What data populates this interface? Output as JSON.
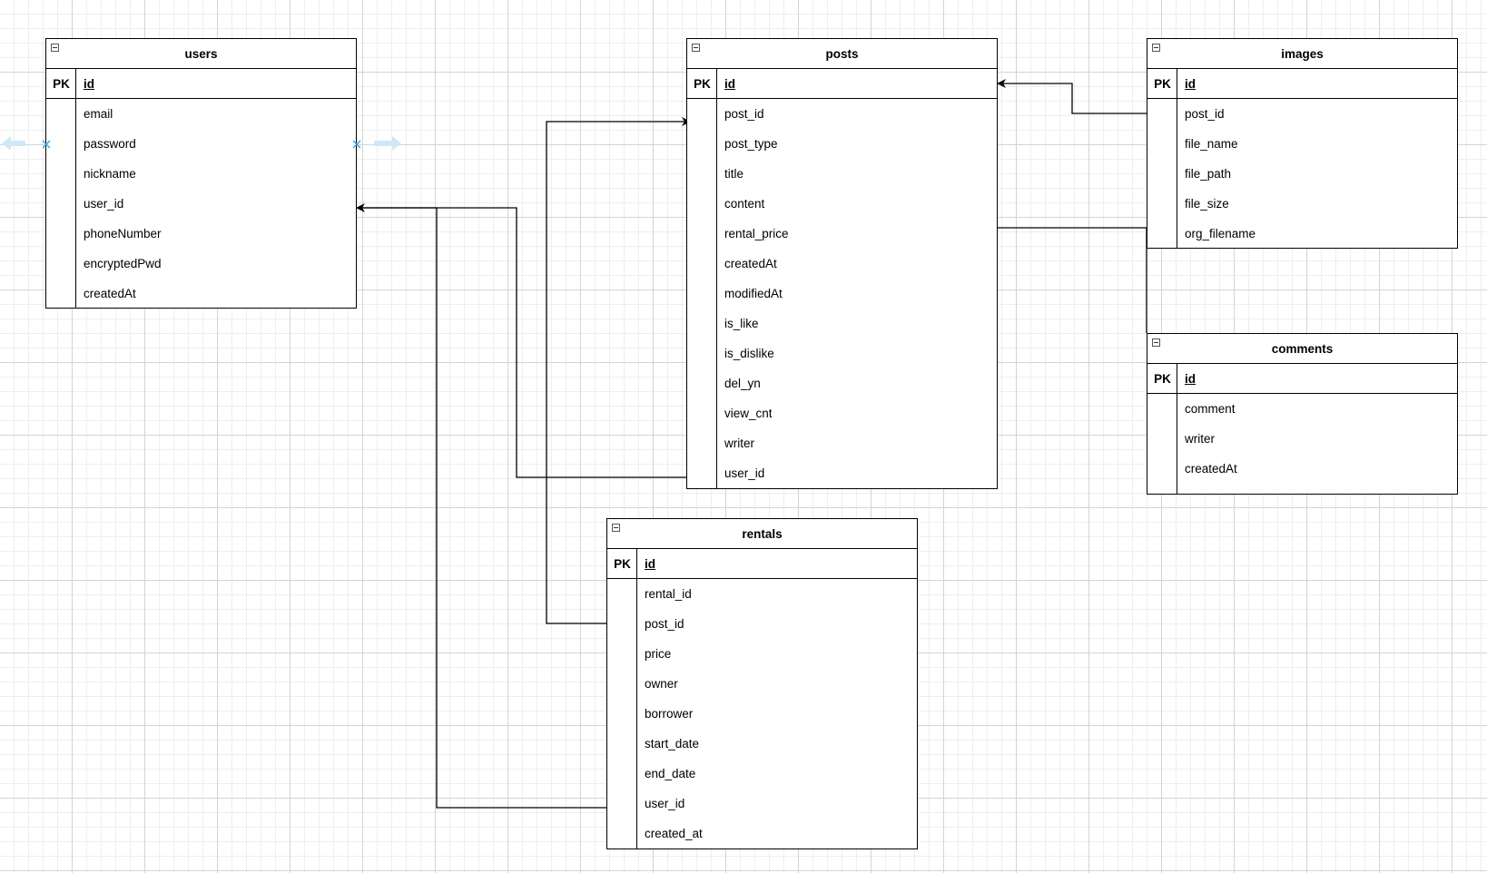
{
  "diagram": {
    "entities": [
      {
        "key": "users",
        "title": "users",
        "pk_label": "PK",
        "pk_field": "id",
        "fields": [
          "email",
          "password",
          "nickname",
          "user_id",
          "phoneNumber",
          "encryptedPwd",
          "createdAt"
        ]
      },
      {
        "key": "posts",
        "title": "posts",
        "pk_label": "PK",
        "pk_field": "id",
        "fields": [
          "post_id",
          "post_type",
          "title",
          "content",
          "rental_price",
          "createdAt",
          "modifiedAt",
          "is_like",
          "is_dislike",
          "del_yn",
          "view_cnt",
          "writer",
          "user_id"
        ]
      },
      {
        "key": "images",
        "title": "images",
        "pk_label": "PK",
        "pk_field": "id",
        "fields": [
          "post_id",
          "file_name",
          "file_path",
          "file_size",
          "org_filename"
        ]
      },
      {
        "key": "comments",
        "title": "comments",
        "pk_label": "PK",
        "pk_field": "id",
        "fields": [
          "comment",
          "writer",
          "createdAt"
        ]
      },
      {
        "key": "rentals",
        "title": "rentals",
        "pk_label": "PK",
        "pk_field": "id",
        "fields": [
          "rental_id",
          "post_id",
          "price",
          "owner",
          "borrower",
          "start_date",
          "end_date",
          "user_id",
          "created_at"
        ]
      }
    ],
    "relationships": [
      {
        "from": "posts.user_id",
        "to": "users.user_id"
      },
      {
        "from": "rentals.user_id",
        "to": "users.user_id"
      },
      {
        "from": "rentals.post_id",
        "to": "posts.post_id"
      },
      {
        "from": "images.post_id",
        "to": "posts.id"
      },
      {
        "from": "comments",
        "to": "posts"
      }
    ],
    "colors": {
      "line": "#000000",
      "selection_handle": "#29a3e0"
    }
  }
}
